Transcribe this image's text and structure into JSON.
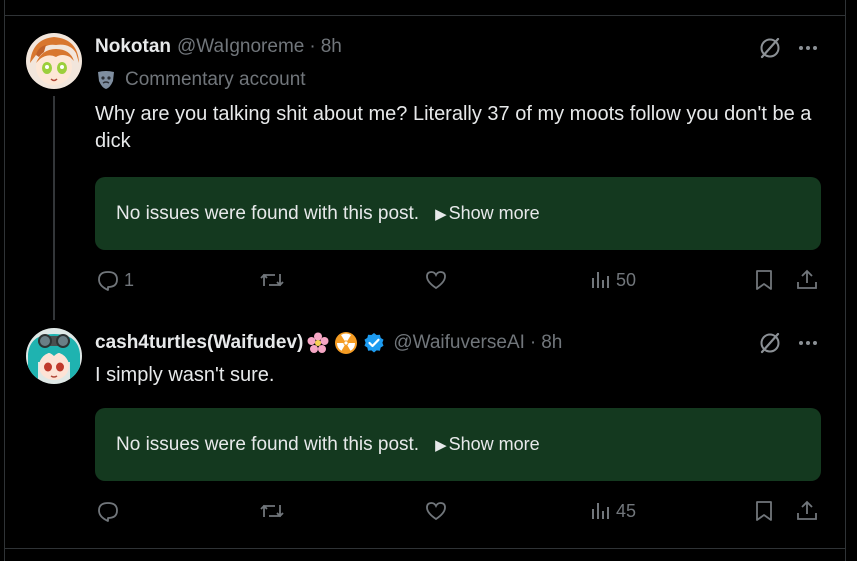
{
  "posts": [
    {
      "display_name": "Nokotan",
      "handle": "@WaIgnoreme",
      "dot": "·",
      "time": "8h",
      "badge_label": "Commentary account",
      "text": "Why are you talking shit about me? Literally 37 of my moots follow you don't be a dick",
      "note": {
        "text": "No issues were found with this post.",
        "show_more": "Show more"
      },
      "actions": {
        "replies": "1",
        "reposts": "",
        "likes": "",
        "views": "50"
      }
    },
    {
      "display_name": "cash4turtles(Waifudev)",
      "handle": "@WaifuverseAI",
      "dot": "·",
      "time": "8h",
      "text": "I simply wasn't sure.",
      "note": {
        "text": "No issues were found with this post.",
        "show_more": "Show more"
      },
      "actions": {
        "replies": "",
        "reposts": "",
        "likes": "",
        "views": "45"
      }
    }
  ],
  "colors": {
    "background": "#000000",
    "text": "#e7e9ea",
    "muted": "#71767b",
    "note_bg": "#14391f",
    "verified": "#1d9bf0"
  },
  "icons": [
    "grok-icon",
    "more-icon",
    "mask-icon",
    "flower-emoji",
    "radioactive-emoji",
    "verified-badge",
    "reply-icon",
    "repost-icon",
    "like-icon",
    "views-icon",
    "bookmark-icon",
    "share-icon"
  ]
}
